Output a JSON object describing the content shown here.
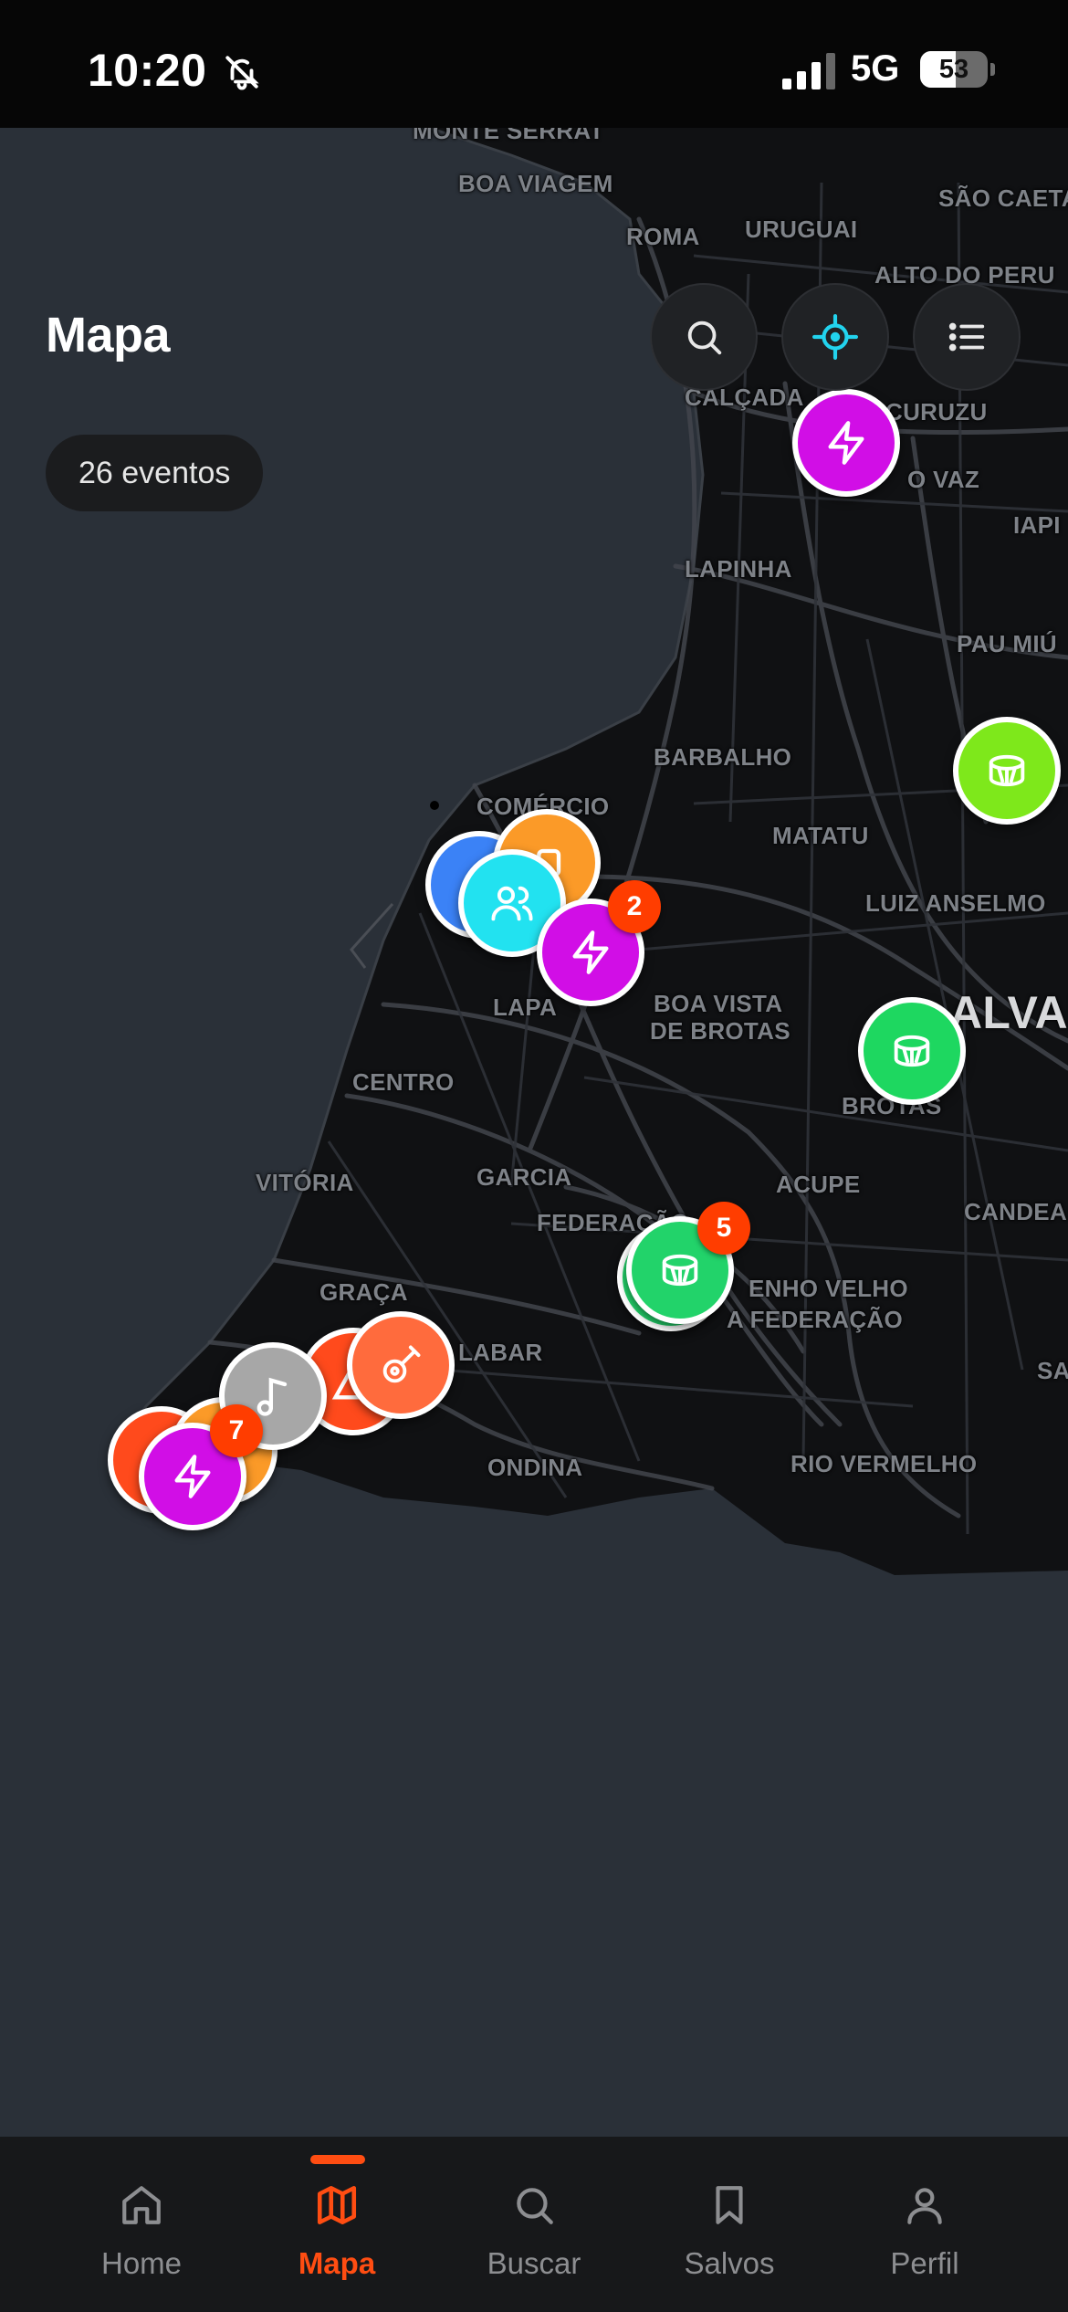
{
  "status_bar": {
    "time": "10:20",
    "network": "5G",
    "battery": "53",
    "battery_level": 0.53,
    "icons": [
      "bell-muted-icon",
      "signal-icon",
      "battery-icon"
    ]
  },
  "header": {
    "title": "Mapa",
    "event_count": "26 eventos"
  },
  "map_controls": [
    {
      "name": "search",
      "icon": "search-icon"
    },
    {
      "name": "locate",
      "icon": "crosshair-icon",
      "color": "#22d3ee"
    },
    {
      "name": "list",
      "icon": "list-icon"
    }
  ],
  "map_labels": {
    "monte_serrat": "Monte Serrat",
    "boa_viagem": "Boa Viagem",
    "roma": "Roma",
    "uruguai": "Uruguai",
    "sao_caetano": "São Caeta",
    "alto_do_peru": "Alto do Peru",
    "calcada": "Calçada",
    "curuzu": "Curuzu",
    "liberdade_vaz": "o Vaz",
    "iapi": "IAPI",
    "lapinha": "Lapinha",
    "pau_miudo": "Pau Miú",
    "barbalho": "Barbalho",
    "comercio": "Comércio",
    "matatu": "Matatu",
    "luiz_anselmo": "Luiz Anselmo",
    "salvador": "ALVAD",
    "lapa": "Lapa",
    "boa_vista_line1": "Boa Vista",
    "boa_vista_line2": "de Brotas",
    "brotas": "Brotas",
    "centro": "Centro",
    "vitoria": "Vitória",
    "garcia": "Garcia",
    "acupe": "Acupe",
    "candeal": "Candea",
    "federacao": "Federação",
    "engenho_velho_1": "enho Velho",
    "engenho_velho_2": "a Federação",
    "graca": "Graça",
    "barra_avenida": "Labar",
    "sa": "Sa",
    "ondina": "Ondina",
    "rio_vermelho": "Rio Vermelho"
  },
  "markers": {
    "sao_caetano_bolt": {
      "icon": "bolt-icon",
      "color": "#d10ee6"
    },
    "pau_miudo_drum": {
      "icon": "drum-icon",
      "color": "#7ee81b"
    },
    "comercio_blue": {
      "icon": "person-icon",
      "color": "#3b82f6"
    },
    "comercio_orange": {
      "icon": "music-icon",
      "color": "#fb9a28"
    },
    "comercio_people": {
      "icon": "people-icon",
      "color": "#22e2f0"
    },
    "comercio_bolt": {
      "icon": "bolt-icon",
      "color": "#d10ee6",
      "count": "2"
    },
    "brotas_drum": {
      "icon": "drum-icon",
      "color": "#1ed760"
    },
    "federacao_drum": {
      "icon": "drum-icon",
      "color": "#22d36a",
      "count": "5"
    },
    "barra_red": {
      "icon": "tent-icon",
      "color": "#ff4a1c"
    },
    "barra_guitar": {
      "icon": "guitar-icon",
      "color": "#ff6b3d"
    },
    "barra_note": {
      "icon": "music-note-icon",
      "color": "#a7a7a7"
    },
    "barra_back_red": {
      "icon": "person-icon",
      "color": "#ff4a1c"
    },
    "barra_back_orange": {
      "icon": "person-icon",
      "color": "#fb9a28"
    },
    "barra_bolt": {
      "icon": "bolt-icon",
      "color": "#d10ee6",
      "count": "7"
    }
  },
  "bottom_nav": {
    "active": "Mapa",
    "active_color": "#ff4d12",
    "items": [
      {
        "label": "Home",
        "icon": "home-icon"
      },
      {
        "label": "Mapa",
        "icon": "map-icon"
      },
      {
        "label": "Buscar",
        "icon": "search-icon"
      },
      {
        "label": "Salvos",
        "icon": "bookmark-icon"
      },
      {
        "label": "Perfil",
        "icon": "user-icon"
      }
    ]
  }
}
